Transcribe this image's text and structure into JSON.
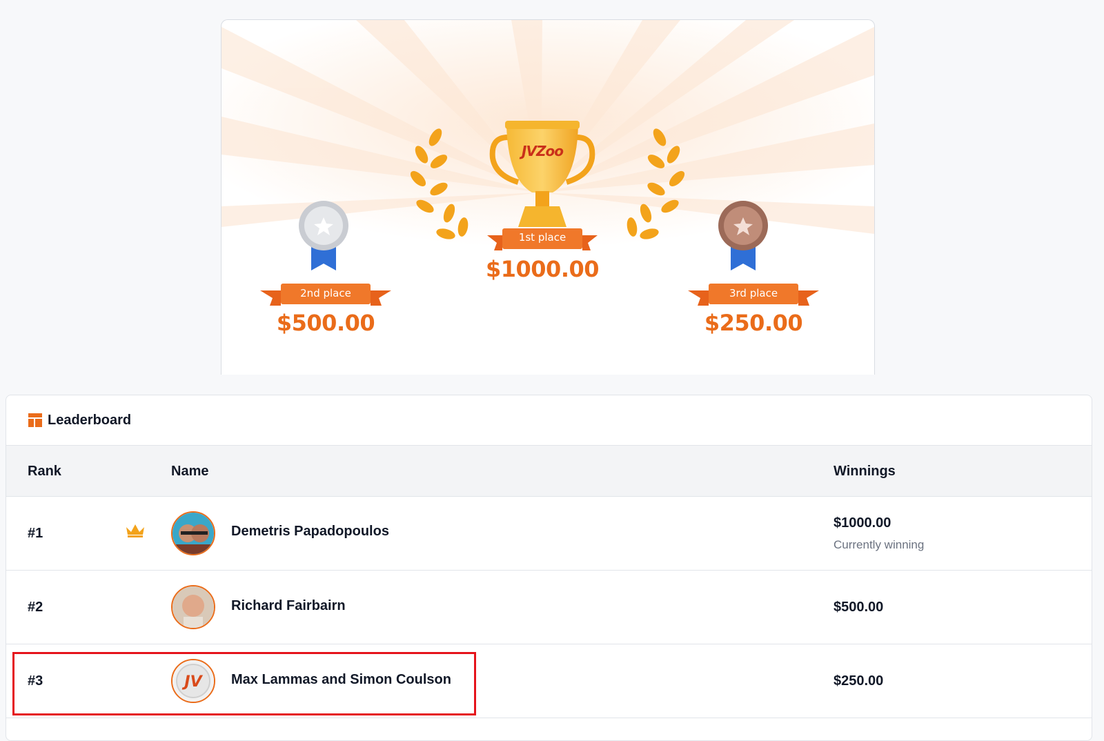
{
  "prizes": {
    "first": {
      "label": "1st place",
      "amount": "$1000.00"
    },
    "second": {
      "label": "2nd place",
      "amount": "$500.00"
    },
    "third": {
      "label": "3rd place",
      "amount": "$250.00"
    },
    "trophy_logo": "JVZoo"
  },
  "leaderboard": {
    "title": "Leaderboard",
    "icon": "layout-icon",
    "columns": {
      "rank": "Rank",
      "name": "Name",
      "winnings": "Winnings"
    },
    "rows": [
      {
        "rank": "#1",
        "name": "Demetris Papadopoulos",
        "winnings": "$1000.00",
        "status": "Currently winning",
        "crown": true
      },
      {
        "rank": "#2",
        "name": "Richard Fairbairn",
        "winnings": "$500.00"
      },
      {
        "rank": "#3",
        "name": "Max Lammas and Simon Coulson",
        "winnings": "$250.00",
        "highlighted": true
      }
    ]
  },
  "colors": {
    "accent": "#ea6c1a",
    "highlight": "#e5141b"
  }
}
